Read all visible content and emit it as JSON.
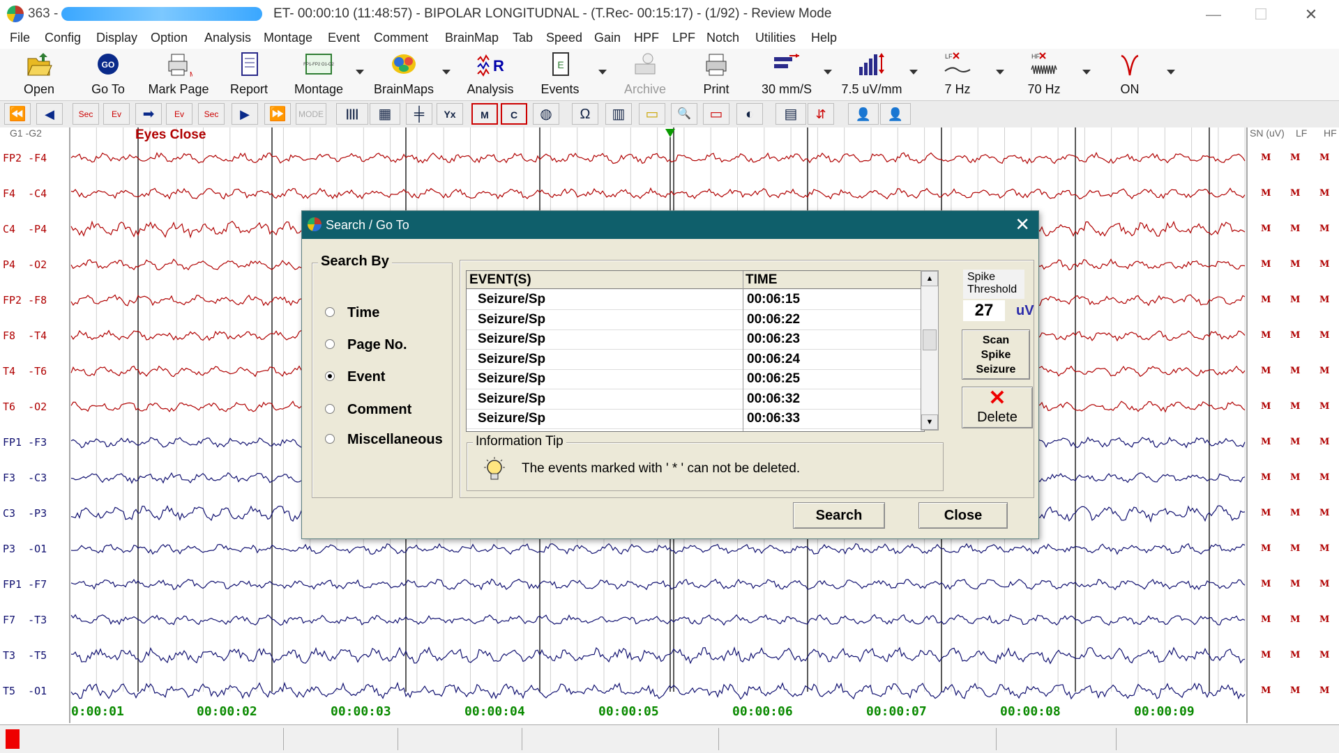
{
  "window": {
    "title_prefix": "363 -",
    "title": "ET- 00:00:10 (11:48:57) - BIPOLAR LONGITUDNAL - (T.Rec- 00:15:17) - (1/92) - Review Mode",
    "minimize": "—",
    "maximize": "☐",
    "close": "✕"
  },
  "menu": [
    "File",
    "Config",
    "Display",
    "Option",
    "Analysis",
    "Montage",
    "Event",
    "Comment",
    "BrainMap",
    "Tab",
    "Speed",
    "Gain",
    "HPF",
    "LPF",
    "Notch",
    "Utilities",
    "Help"
  ],
  "toolbar": {
    "open": "Open",
    "goto": "Go To",
    "mark_page": "Mark Page",
    "report": "Report",
    "montage": "Montage",
    "brainmaps": "BrainMaps",
    "analysis": "Analysis",
    "events": "Events",
    "archive": "Archive",
    "print": "Print",
    "speed": "30  mm/S",
    "gain": "7.5 uV/mm",
    "lf": "7 Hz",
    "hf": "70 Hz",
    "notch": "ON",
    "montage_icon_text": "FP1-FP2 O1-O2",
    "goto_icon_text": "GO",
    "mark_icon_text": "M",
    "lf_icon_text": "LF",
    "hf_icon_text": "HF"
  },
  "navbar": [
    "⏪",
    "◀",
    "Sec",
    "Ev",
    "➡",
    "Ev",
    "Sec",
    "▶",
    "⏩",
    "MODE",
    "||||",
    "▦",
    "╪",
    "Yx",
    "M",
    "C",
    "◍",
    "Ω",
    "▥",
    "▭",
    "🔍",
    "▭",
    "◐",
    "▤",
    "⇵",
    "👤",
    "👤"
  ],
  "eeg": {
    "header_left": "G1  -G2",
    "header_right": [
      "SN (uV)",
      "LF",
      "HF"
    ],
    "event_label": "Eyes Close",
    "marker": "M",
    "channels": [
      {
        "label": "FP2 -F4",
        "color": "red"
      },
      {
        "label": "F4  -C4",
        "color": "red"
      },
      {
        "label": "C4  -P4",
        "color": "red"
      },
      {
        "label": "P4  -O2",
        "color": "red"
      },
      {
        "label": "FP2 -F8",
        "color": "red"
      },
      {
        "label": "F8  -T4",
        "color": "red"
      },
      {
        "label": "T4  -T6",
        "color": "red"
      },
      {
        "label": "T6  -O2",
        "color": "red"
      },
      {
        "label": "FP1 -F3",
        "color": "blue"
      },
      {
        "label": "F3  -C3",
        "color": "blue"
      },
      {
        "label": "C3  -P3",
        "color": "blue"
      },
      {
        "label": "P3  -O1",
        "color": "blue"
      },
      {
        "label": "FP1 -F7",
        "color": "blue"
      },
      {
        "label": "F7  -T3",
        "color": "blue"
      },
      {
        "label": "T3  -T5",
        "color": "blue"
      },
      {
        "label": "T5  -O1",
        "color": "blue"
      }
    ],
    "time_labels": [
      "0:00:01",
      "00:00:02",
      "00:00:03",
      "00:00:04",
      "00:00:05",
      "00:00:06",
      "00:00:07",
      "00:00:08",
      "00:00:09"
    ],
    "colors": {
      "red": "#b00000",
      "blue": "#101070",
      "grid": "#000000",
      "time": "#0a8a00"
    }
  },
  "dialog": {
    "title": "Search / Go To",
    "close": "✕",
    "search_by": {
      "title": "Search By",
      "options": [
        {
          "label": "Time",
          "checked": false
        },
        {
          "label": "Page No.",
          "checked": false
        },
        {
          "label": "Event",
          "checked": true
        },
        {
          "label": "Comment",
          "checked": false
        },
        {
          "label": "Miscellaneous",
          "checked": false
        }
      ]
    },
    "table": {
      "headers": [
        "EVENT(S)",
        "TIME"
      ],
      "rows": [
        [
          "Seizure/Sp",
          "00:06:15"
        ],
        [
          "Seizure/Sp",
          "00:06:22"
        ],
        [
          "Seizure/Sp",
          "00:06:23"
        ],
        [
          "Seizure/Sp",
          "00:06:24"
        ],
        [
          "Seizure/Sp",
          "00:06:25"
        ],
        [
          "Seizure/Sp",
          "00:06:32"
        ],
        [
          "Seizure/Sp",
          "00:06:33"
        ]
      ],
      "scroll_up": "▲",
      "scroll_down": "▼"
    },
    "spike": {
      "label": "Spike\nThreshold",
      "value": "27",
      "unit": "uV",
      "scan_button": "Scan\nSpike\nSeizure",
      "delete_button": "Delete",
      "delete_icon": "✕"
    },
    "info": {
      "title": "Information Tip",
      "text": "The events marked with ' * ' can not be deleted."
    },
    "search_button": "Search",
    "close_button": "Close"
  }
}
